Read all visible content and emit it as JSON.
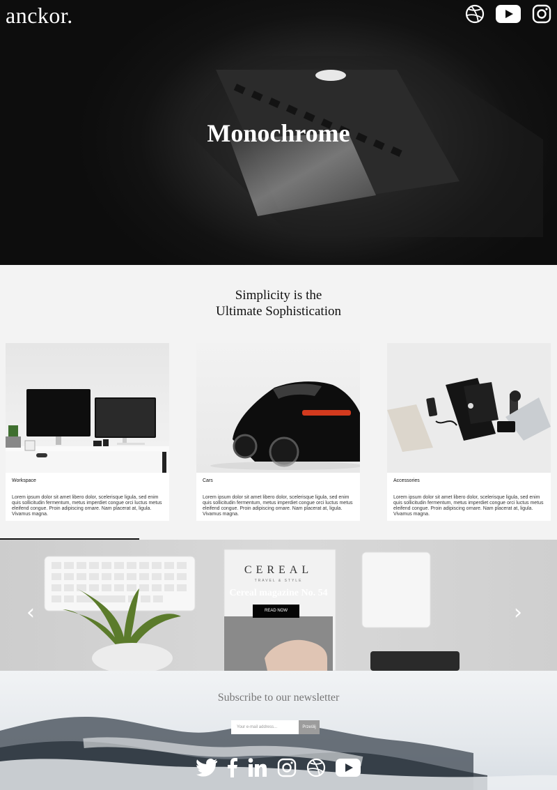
{
  "brand": {
    "logo": "anckor."
  },
  "header": {
    "social": [
      "dribbble-icon",
      "youtube-icon",
      "instagram-icon"
    ]
  },
  "hero": {
    "title": "Monochrome"
  },
  "intro": {
    "line1": "Simplicity is the",
    "line2": "Ultimate Sophistication"
  },
  "cards": [
    {
      "caption": "Workspace",
      "text": "Lorem ipsum dolor sit amet libero dolor, scelerisque ligula, sed enim quis sollicitudin fermentum, metus imperdiet congue orci luctus metus eleifend congue. Proin adipiscing ornare. Nam placerat at, ligula. Vivamus magna."
    },
    {
      "caption": "Cars",
      "text": "Lorem ipsum dolor sit amet libero dolor, scelerisque ligula, sed enim quis sollicitudin fermentum, metus imperdiet congue orci luctus metus eleifend congue. Proin adipiscing ornare. Nam placerat at, ligula. Vivamus magna."
    },
    {
      "caption": "Accessories",
      "text": "Lorem ipsum dolor sit amet libero dolor, scelerisque ligula, sed enim quis sollicitudin fermentum, metus imperdiet congue orci luctus metus eleifend congue. Proin adipiscing ornare. Nam placerat at, ligula. Vivamus magna."
    }
  ],
  "slider": {
    "magazine_name": "CEREAL",
    "magazine_sub": "TRAVEL & STYLE",
    "title": "Cereal magazine No. 54",
    "button": "READ NOW",
    "prev": "‹",
    "next": "›"
  },
  "newsletter": {
    "title": "Subscribe to our newsletter",
    "placeholder": "Your e-mail address...",
    "submit": "Prześlij"
  },
  "footer": {
    "social": [
      "twitter-icon",
      "facebook-icon",
      "linkedin-icon",
      "instagram-icon",
      "dribbble-icon",
      "youtube-icon"
    ]
  }
}
